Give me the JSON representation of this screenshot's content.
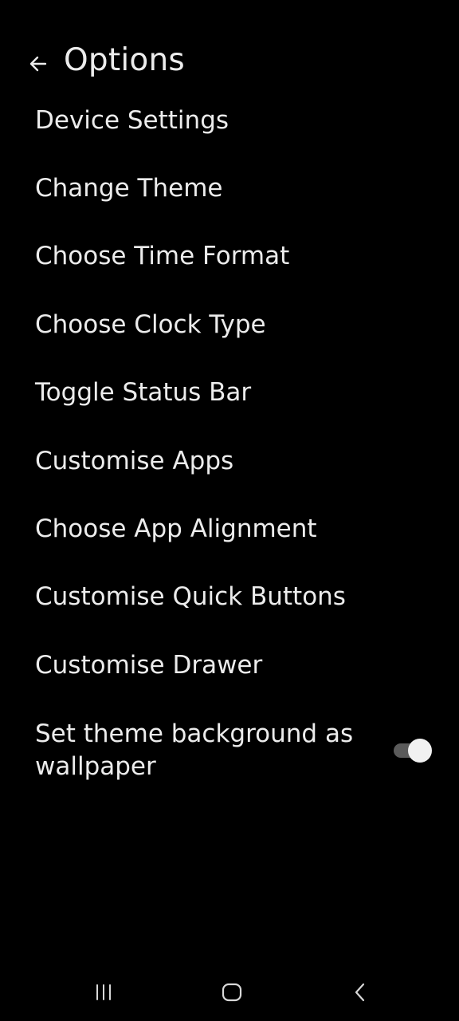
{
  "header": {
    "title": "Options",
    "back_icon": "arrow-left-icon"
  },
  "menu": {
    "items": [
      {
        "label": "Device Settings"
      },
      {
        "label": "Change Theme"
      },
      {
        "label": "Choose Time Format"
      },
      {
        "label": "Choose Clock Type"
      },
      {
        "label": "Toggle Status Bar"
      },
      {
        "label": "Customise Apps"
      },
      {
        "label": "Choose App Alignment"
      },
      {
        "label": "Customise Quick Buttons"
      },
      {
        "label": "Customise Drawer"
      }
    ]
  },
  "wallpaper_setting": {
    "label": "Set theme background as wallpaper",
    "enabled": true
  },
  "navbar": {
    "recents_icon": "recent-apps-icon",
    "home_icon": "home-icon",
    "back_icon": "back-chevron-icon"
  },
  "colors": {
    "background": "#000000",
    "text": "#ececec",
    "switch_track": "#5b5b5b",
    "switch_thumb": "#f1f1f1"
  }
}
